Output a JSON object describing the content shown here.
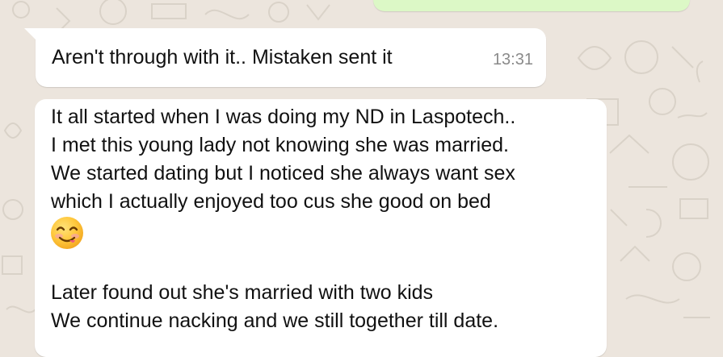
{
  "chat": {
    "messages": [
      {
        "type": "incoming",
        "text": "Aren't through with it..  Mistaken sent it",
        "time": "13:31"
      },
      {
        "type": "incoming",
        "lines": [
          "It all started when I was doing my ND in Laspotech..",
          "I met this young lady not knowing she was married.",
          "We started dating but I noticed she always want sex",
          "which I actually enjoyed too cus she good on bed"
        ],
        "emoji": "smiling-face-with-tongue",
        "later_lines": [
          "Later found out she's married with two kids",
          "We continue nacking and we still together till date."
        ]
      }
    ]
  },
  "colors": {
    "wallpaper": "#ece5dd",
    "incoming_bubble": "#ffffff",
    "outgoing_bubble": "#dcf8c6",
    "timestamp": "#8a8a8a"
  }
}
